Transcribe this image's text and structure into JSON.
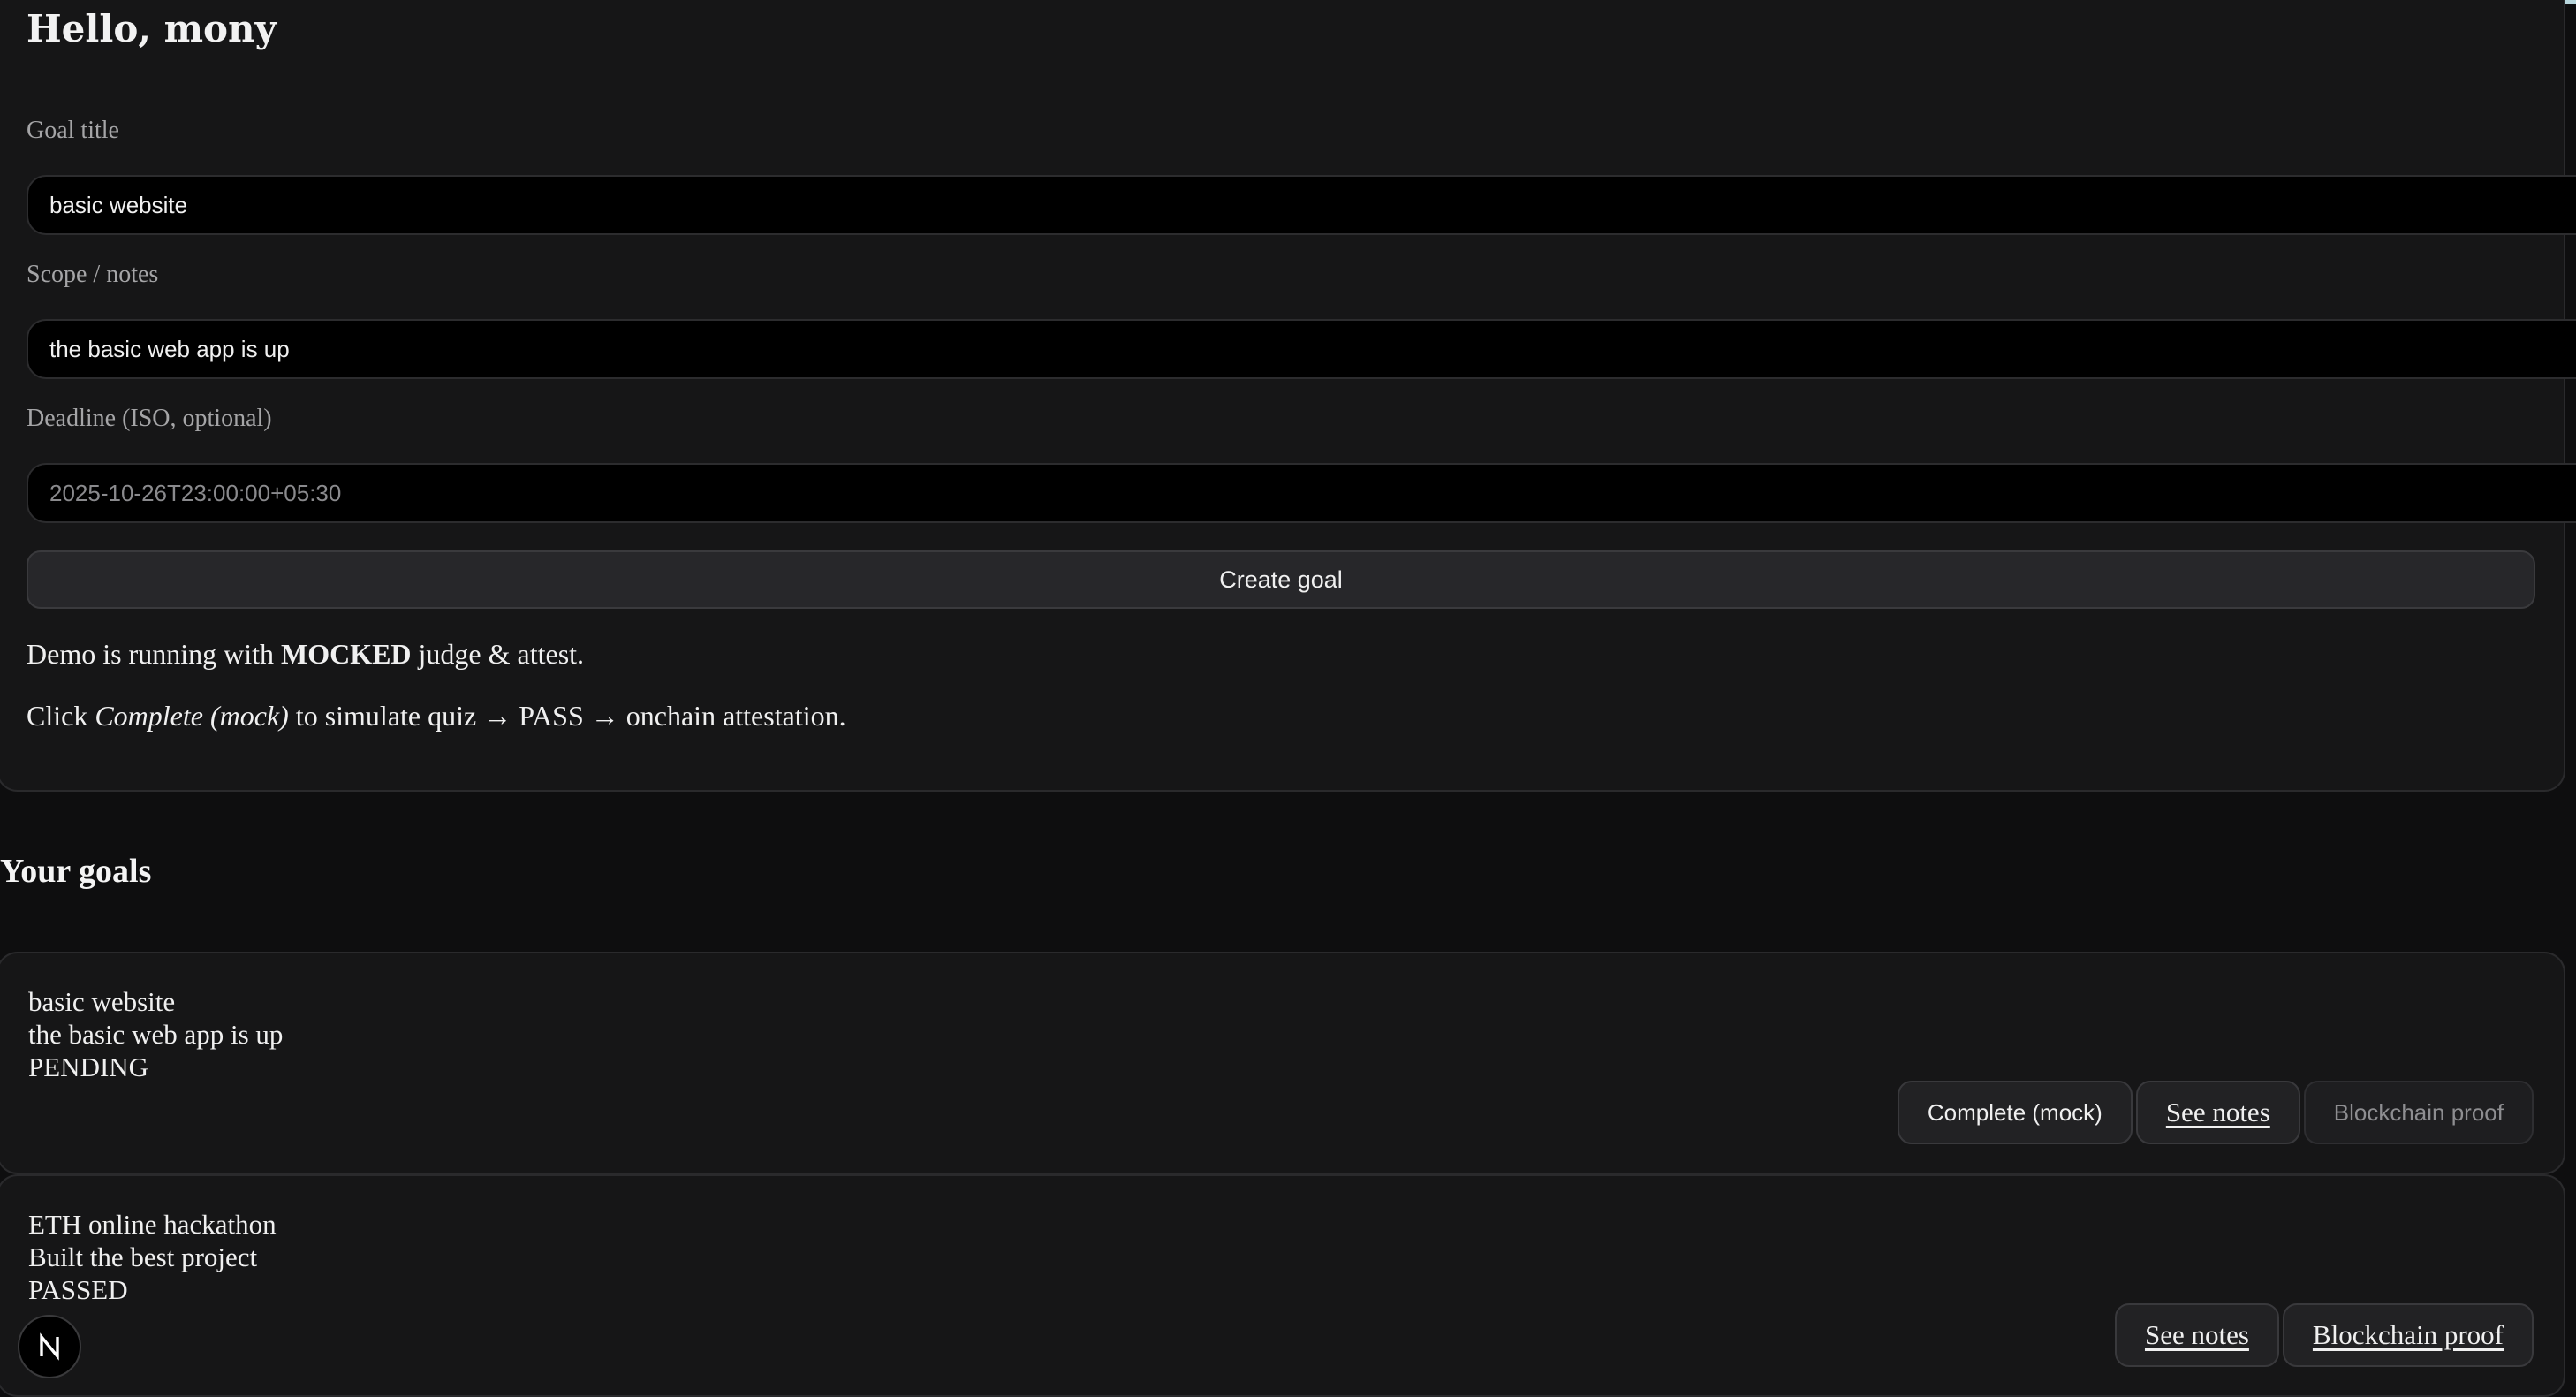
{
  "greeting": "Hello, mony",
  "form": {
    "goal_title_label": "Goal title",
    "goal_title_value": "basic website",
    "scope_label": "Scope / notes",
    "scope_value": "the basic web app is up",
    "deadline_label": "Deadline (ISO, optional)",
    "deadline_placeholder": "2025-10-26T23:00:00+05:30",
    "create_button": "Create goal"
  },
  "info": {
    "line1_prefix": "Demo is running with ",
    "line1_bold": "MOCKED",
    "line1_suffix": " judge & attest.",
    "line2_prefix": "Click ",
    "line2_italic": "Complete (mock)",
    "line2_suffix": " to simulate quiz → PASS → onchain attestation."
  },
  "goals_section_title": "Your goals",
  "goals": [
    {
      "title": "basic website",
      "notes": "the basic web app is up",
      "status": "PENDING",
      "complete_label": "Complete (mock)",
      "see_notes_label": "See notes",
      "proof_label": "Blockchain proof"
    },
    {
      "title": "ETH online hackathon",
      "notes": "Built the best project",
      "status": "PASSED",
      "see_notes_label": "See notes",
      "proof_label": "Blockchain proof"
    }
  ],
  "dev_badge": {
    "icon": "nextjs-icon"
  }
}
